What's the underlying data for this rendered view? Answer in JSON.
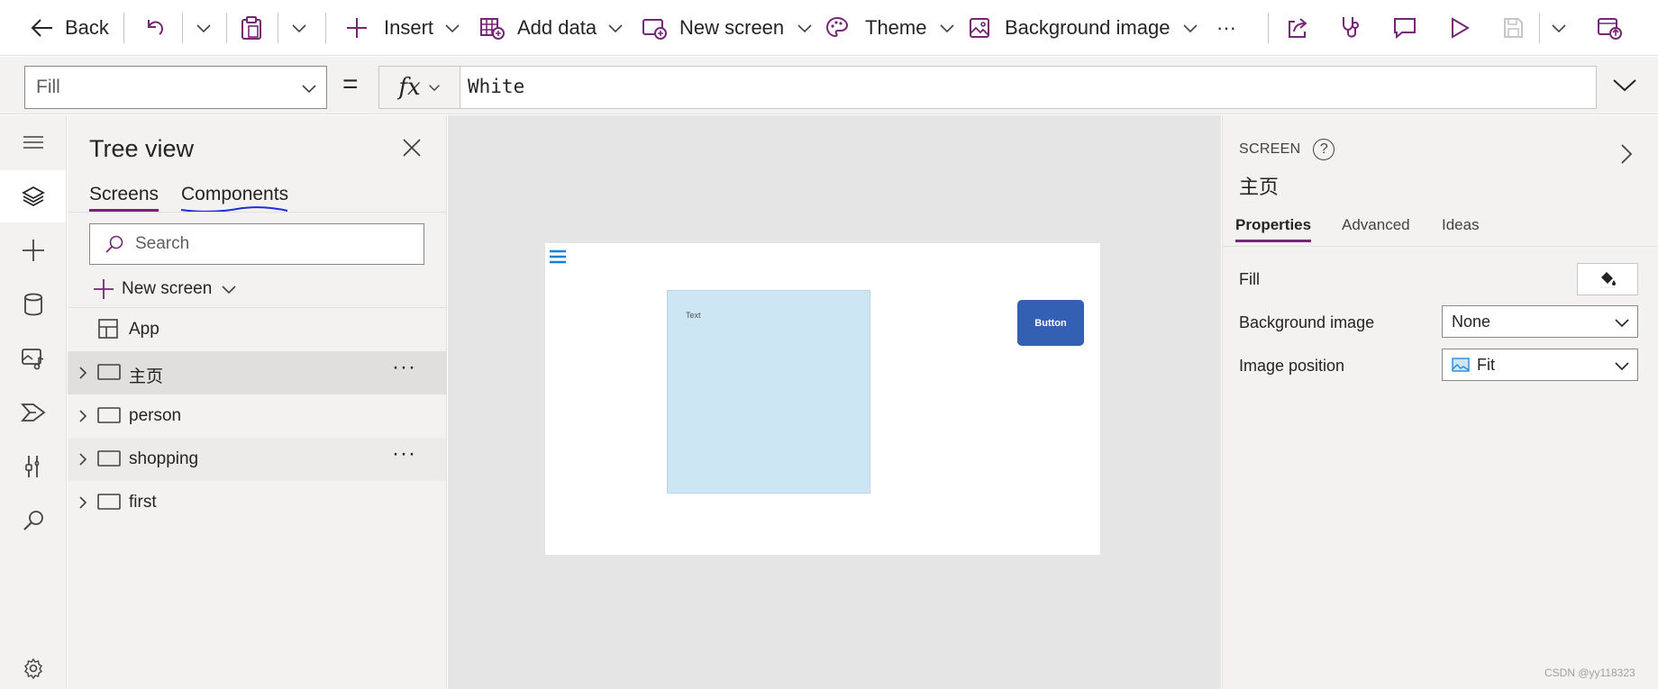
{
  "toolbar": {
    "back": "Back",
    "insert": "Insert",
    "add_data": "Add data",
    "new_screen": "New screen",
    "theme": "Theme",
    "background_image": "Background image",
    "more": "···"
  },
  "formula_bar": {
    "property": "Fill",
    "equals": "=",
    "fx": "fx",
    "value": "White"
  },
  "tree_view": {
    "title": "Tree view",
    "tabs": [
      "Screens",
      "Components"
    ],
    "search_placeholder": "Search",
    "new_screen": "New screen",
    "nodes": [
      {
        "label": "App"
      },
      {
        "label": "主页",
        "more": "···"
      },
      {
        "label": "person"
      },
      {
        "label": "shopping",
        "more": "···"
      },
      {
        "label": "first"
      }
    ]
  },
  "canvas": {
    "text_label": "Text",
    "button_label": "Button"
  },
  "properties_pane": {
    "kind": "SCREEN",
    "help": "?",
    "screen_name": "主页",
    "tabs": [
      "Properties",
      "Advanced",
      "Ideas"
    ],
    "rows": {
      "fill_label": "Fill",
      "background_image_label": "Background image",
      "background_image_value": "None",
      "image_position_label": "Image position",
      "image_position_value": "Fit"
    }
  },
  "watermark": "CSDN @yy118323",
  "colors": {
    "accent": "#742774",
    "button": "#3460b4",
    "textbox": "#cde6f4",
    "canvas_bg": "#e5e5e5"
  }
}
